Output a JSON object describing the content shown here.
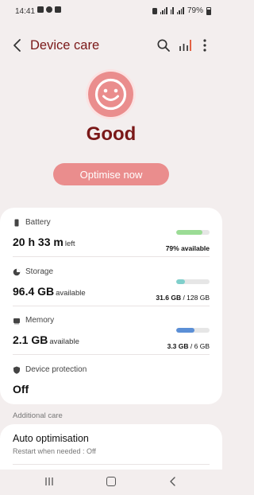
{
  "status_bar": {
    "time": "14:41",
    "battery_percent": "79%"
  },
  "app_bar": {
    "title": "Device care"
  },
  "overview": {
    "status": "Good",
    "optimise_button": "Optimise now"
  },
  "items": [
    {
      "id": "battery",
      "label": "Battery",
      "value": "20 h 33 m",
      "unit": "left",
      "right_text_strong": "79% available",
      "right_text_rest": "",
      "bar_fraction": 0.79,
      "bar_color": "#9bdc95"
    },
    {
      "id": "storage",
      "label": "Storage",
      "value": "96.4 GB",
      "unit": "available",
      "right_text_strong": "31.6 GB",
      "right_text_rest": " / 128 GB",
      "bar_fraction": 0.25,
      "bar_color": "#7fcfcb"
    },
    {
      "id": "memory",
      "label": "Memory",
      "value": "2.1 GB",
      "unit": "available",
      "right_text_strong": "3.3 GB",
      "right_text_rest": " / 6 GB",
      "bar_fraction": 0.55,
      "bar_color": "#5b8fd6"
    },
    {
      "id": "device_protection",
      "label": "Device protection",
      "value": "Off"
    }
  ],
  "additional_care": {
    "heading": "Additional care",
    "auto_optimisation": {
      "title": "Auto optimisation",
      "subtitle": "Restart when needed : Off"
    }
  },
  "colors": {
    "accent": "#7a1818",
    "face": "#ea8d8d",
    "background": "#f3eeee"
  }
}
